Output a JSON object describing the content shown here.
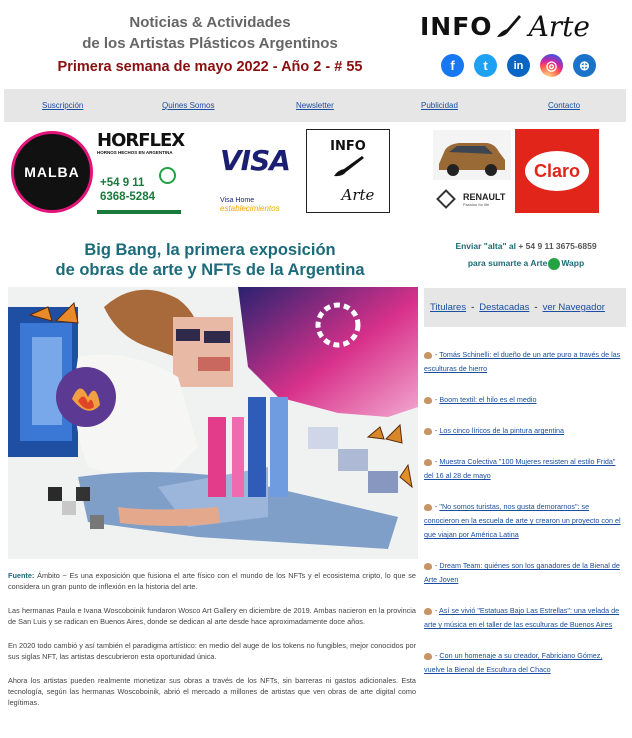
{
  "header": {
    "line1": "Noticias & Actividades",
    "line2": "de los Artistas Plásticos Argentinos",
    "edition": "Primera semana de mayo 2022 - Año 2 - # 55",
    "logo_info": "INFO",
    "logo_arte": "Arte"
  },
  "social": [
    {
      "name": "facebook-icon",
      "glyph": "f"
    },
    {
      "name": "twitter-icon",
      "glyph": "t"
    },
    {
      "name": "linkedin-icon",
      "glyph": "in"
    },
    {
      "name": "instagram-icon",
      "glyph": "◎"
    },
    {
      "name": "web-icon",
      "glyph": "⊕"
    }
  ],
  "nav": [
    {
      "label": "Suscripción"
    },
    {
      "label": "Quines Somos"
    },
    {
      "label": "Newsletter"
    },
    {
      "label": "Publicidad"
    },
    {
      "label": "Contacto"
    }
  ],
  "ads": {
    "malba": "MALBA",
    "horflex_title": "HORFLEX",
    "horflex_sub": "HORNOS HECHOS EN ARGENTINA",
    "horflex_phone1": "+54 9 11",
    "horflex_phone2": "6368-5284",
    "visa": "VISA",
    "visa_sub1": "Visa Home",
    "visa_sub2": "establecimientos",
    "infoarte_1": "INFO",
    "infoarte_2": "Arte",
    "renault": "RENAULT",
    "renault_sub": "Passion for life",
    "claro": "Claro"
  },
  "article": {
    "title_line1": "Big Bang, la primera exposición",
    "title_line2": "de obras de arte y NFTs de la Argentina",
    "source_label": "Fuente:",
    "p1": " Ámbito ~ Es una exposición que fusiona el arte físico con el mundo de los NFTs y el ecosistema cripto, lo que se considera un gran punto de inflexión en la historia del arte.",
    "p2": "Las hermanas Paula e Ivana Woscoboinik fundaron Wosco Art Gallery en diciembre de 2019. Ambas nacieron en la provincia de San Luis y se radican en Buenos Aires, donde se dedican al arte desde hace aproximadamente doce años.",
    "p3": "En 2020 todo cambió y así también el paradigma artístico: en medio del auge de los tokens no fungibles, mejor conocidos por sus siglas NFT, las artistas descubrieron esta oportunidad única.",
    "p4": "Ahora los artistas pueden realmente monetizar sus obras a través de los NFTs, sin barreras ni gastos adicionales. Esta tecnología, según las hermanas Woscoboinik, abrió el mercado a millones de artistas que ven obras de arte digital como legítimas."
  },
  "sidebar": {
    "enviar_1": "Enviar \"alta\" al",
    "enviar_phone": "+ 54 9 11 3675-6859",
    "enviar_2": "para sumarte a Arte",
    "enviar_3": "Wapp",
    "nav_titulares": "Titulares",
    "nav_destacadas": "Destacadas",
    "nav_navegador": "ver Navegador",
    "items": [
      "Tomás Schinelli: el dueño de un arte puro a través de las esculturas de hierro",
      "Boom textil: el hilo es el medio",
      "Los cinco líricos de la pintura argentina",
      "Muestra Colectiva \"100 Mujeres resisten al estilo Frida\" del 16 al 28 de mayo",
      "\"No somos turistas, nos gusta demorarnos\": se conocieron en la escuela de arte y crearon un proyecto con el que viajan por América Latina",
      "Dream Team: quiénes son los ganadores de la Bienal de Arte Joven",
      "Así se vivió \"Estatuas Bajo Las Estrellas\": una velada de arte y música en el taller de las esculturas de Buenos Aires",
      "Con un homenaje a su creador, Fabriciano Gómez, vuelve la Bienal de Escultura del Chaco"
    ]
  }
}
